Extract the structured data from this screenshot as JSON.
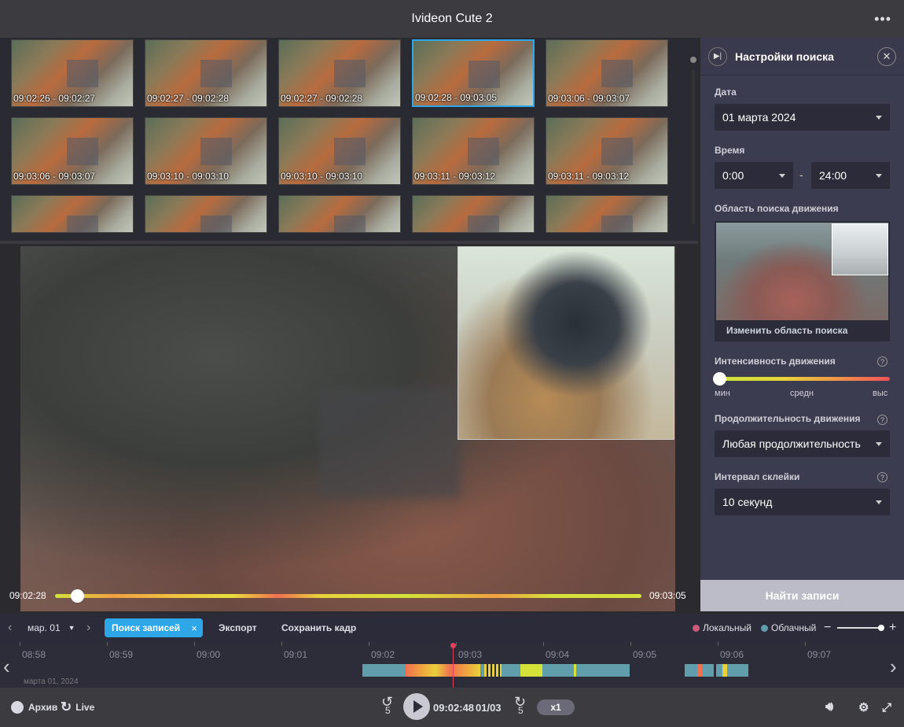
{
  "app": {
    "title": "Ivideon Cute 2",
    "menu_icon": "more-dots-icon"
  },
  "thumbnails": [
    {
      "time": "09:02:26 - 09:02:27"
    },
    {
      "time": "09:02:27 - 09:02:28"
    },
    {
      "time": "09:02:27 - 09:02:28"
    },
    {
      "time": "09:02:28 - 09:03:05",
      "selected": true
    },
    {
      "time": "09:03:06 - 09:03:07"
    },
    {
      "time": "09:03:06 - 09:03:07"
    },
    {
      "time": "09:03:10 - 09:03:10"
    },
    {
      "time": "09:03:10 - 09:03:10"
    },
    {
      "time": "09:03:11 - 09:03:12"
    },
    {
      "time": "09:03:11 - 09:03:12"
    },
    {
      "time": ""
    },
    {
      "time": ""
    },
    {
      "time": ""
    },
    {
      "time": ""
    },
    {
      "time": ""
    }
  ],
  "player": {
    "start_time": "09:02:28",
    "end_time": "09:03:05",
    "progress": 0.04
  },
  "search_panel": {
    "title": "Настройки поиска",
    "date_label": "Дата",
    "date_value": "01 марта 2024",
    "time_label": "Время",
    "time_from": "0:00",
    "time_separator": "-",
    "time_to": "24:00",
    "area_label": "Область поиска движения",
    "change_area": "Изменить область поиска",
    "intensity_label": "Интенсивность движения",
    "intensity_min": "мин",
    "intensity_mid": "средн",
    "intensity_max": "выс",
    "intensity_level": 0,
    "duration_label": "Продолжительность движения",
    "duration_value": "Любая продолжительность",
    "interval_label": "Интервал склейки",
    "interval_value": "10 секунд",
    "help": "?",
    "find_button": "Найти записи"
  },
  "toolbar": {
    "date_select": "мар. 01",
    "search_records": "Поиск записей",
    "search_close": "×",
    "export": "Экспорт",
    "save_frame": "Сохранить кадр",
    "local": "Локальный",
    "cloud": "Облачный",
    "zoom_out": "−",
    "zoom_in": "+",
    "colors": {
      "local": "#c85a7a",
      "cloud": "#5f9eaa",
      "accent": "#2ea7e8"
    }
  },
  "timeline": {
    "ticks": [
      "08:58",
      "08:59",
      "09:00",
      "09:01",
      "09:02",
      "09:03",
      "09:04",
      "09:05",
      "09:06",
      "09:07"
    ],
    "date": "марта 01, 2024"
  },
  "bottom": {
    "archive": "Архив",
    "live": "Live",
    "back_seconds": "5",
    "forward_seconds": "5",
    "current_time": "09:02:48",
    "current_date": "01/03",
    "speed": "x1"
  }
}
